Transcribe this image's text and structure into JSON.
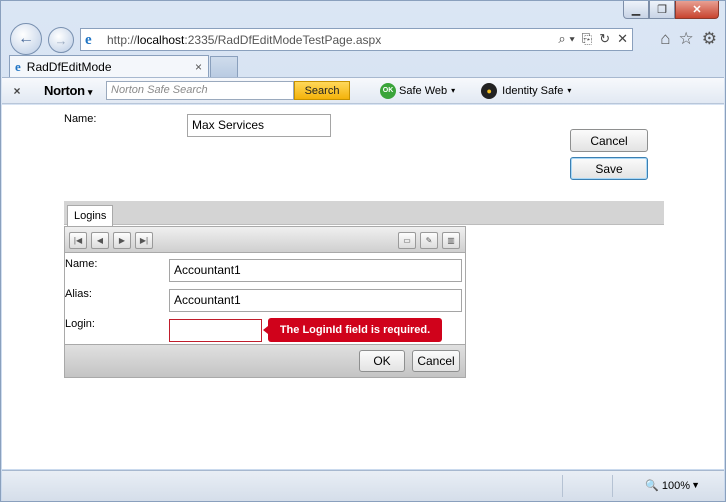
{
  "browser": {
    "url_prefix": "http://",
    "url_host": "localhost",
    "url_rest": ":2335/RadDfEditModeTestPage.aspx",
    "tab_title": "RadDfEditMode",
    "tab_close": "×",
    "addr_icons": [
      "⌕ ▾",
      "⎘",
      "↻",
      "✕"
    ],
    "right_icons": [
      "⌂",
      "☆",
      "⚙"
    ]
  },
  "norton": {
    "close": "×",
    "brand": "Norton",
    "search_placeholder": "Norton Safe Search",
    "search_button": "Search",
    "ok_badge": "OK",
    "safe_web": "Safe Web",
    "identity_safe": "Identity Safe"
  },
  "form": {
    "name_label": "Name:",
    "name_value": "Max Services",
    "cancel_label": "Cancel",
    "save_label": "Save"
  },
  "logins": {
    "tab_label": "Logins",
    "name_label": "Name:",
    "name_value": "Accountant1",
    "alias_label": "Alias:",
    "alias_value": "Accountant1",
    "login_label": "Login:",
    "login_value": "",
    "error_text": "The LoginId field is required.",
    "ok_label": "OK",
    "cancel_label": "Cancel"
  },
  "status": {
    "zoom": "100%"
  }
}
